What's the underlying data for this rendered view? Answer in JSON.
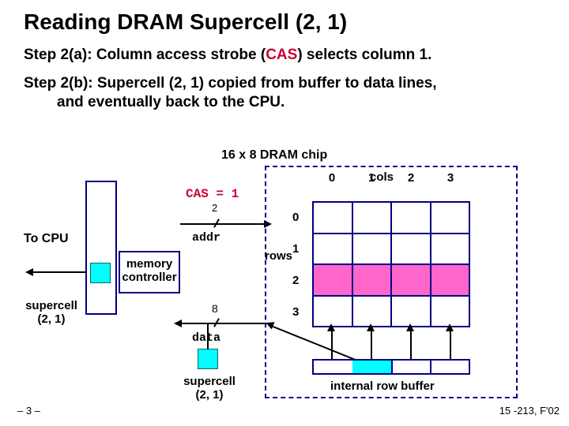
{
  "title": "Reading DRAM Supercell (2, 1)",
  "step_a_prefix": "Step 2(a): Column access strobe (",
  "step_a_cas": "CAS",
  "step_a_suffix": ") selects column 1.",
  "step_b_line1": "Step 2(b): Supercell (2, 1) copied from buffer to data lines,",
  "step_b_line2": "and eventually back to the CPU.",
  "chip_title": "16 x 8 DRAM chip",
  "tocpu": "To CPU",
  "memctrl_l1": "memory",
  "memctrl_l2": "controller",
  "supercell_l1": "supercell",
  "supercell_l2": "(2, 1)",
  "cas": "CAS = 1",
  "wire2": "2",
  "addr": "addr",
  "wire8": "8",
  "data": "data",
  "cols_label": "cols",
  "rows_label": "rows",
  "col0": "0",
  "col1": "1",
  "col2": "2",
  "col3": "3",
  "row0": "0",
  "row1": "1",
  "row2": "2",
  "row3": "3",
  "buf_label": "internal row buffer",
  "footer_left": "– 3 –",
  "footer_right": "15 -213, F'02",
  "chart_data": {
    "type": "diagram",
    "grid": {
      "rows": 4,
      "cols": 4,
      "highlighted_row": 2,
      "selected_cell": [
        2,
        1
      ]
    },
    "signals": {
      "addr_width": 2,
      "data_width": 8,
      "CAS": 1
    },
    "buffer_filled_col": 1
  }
}
